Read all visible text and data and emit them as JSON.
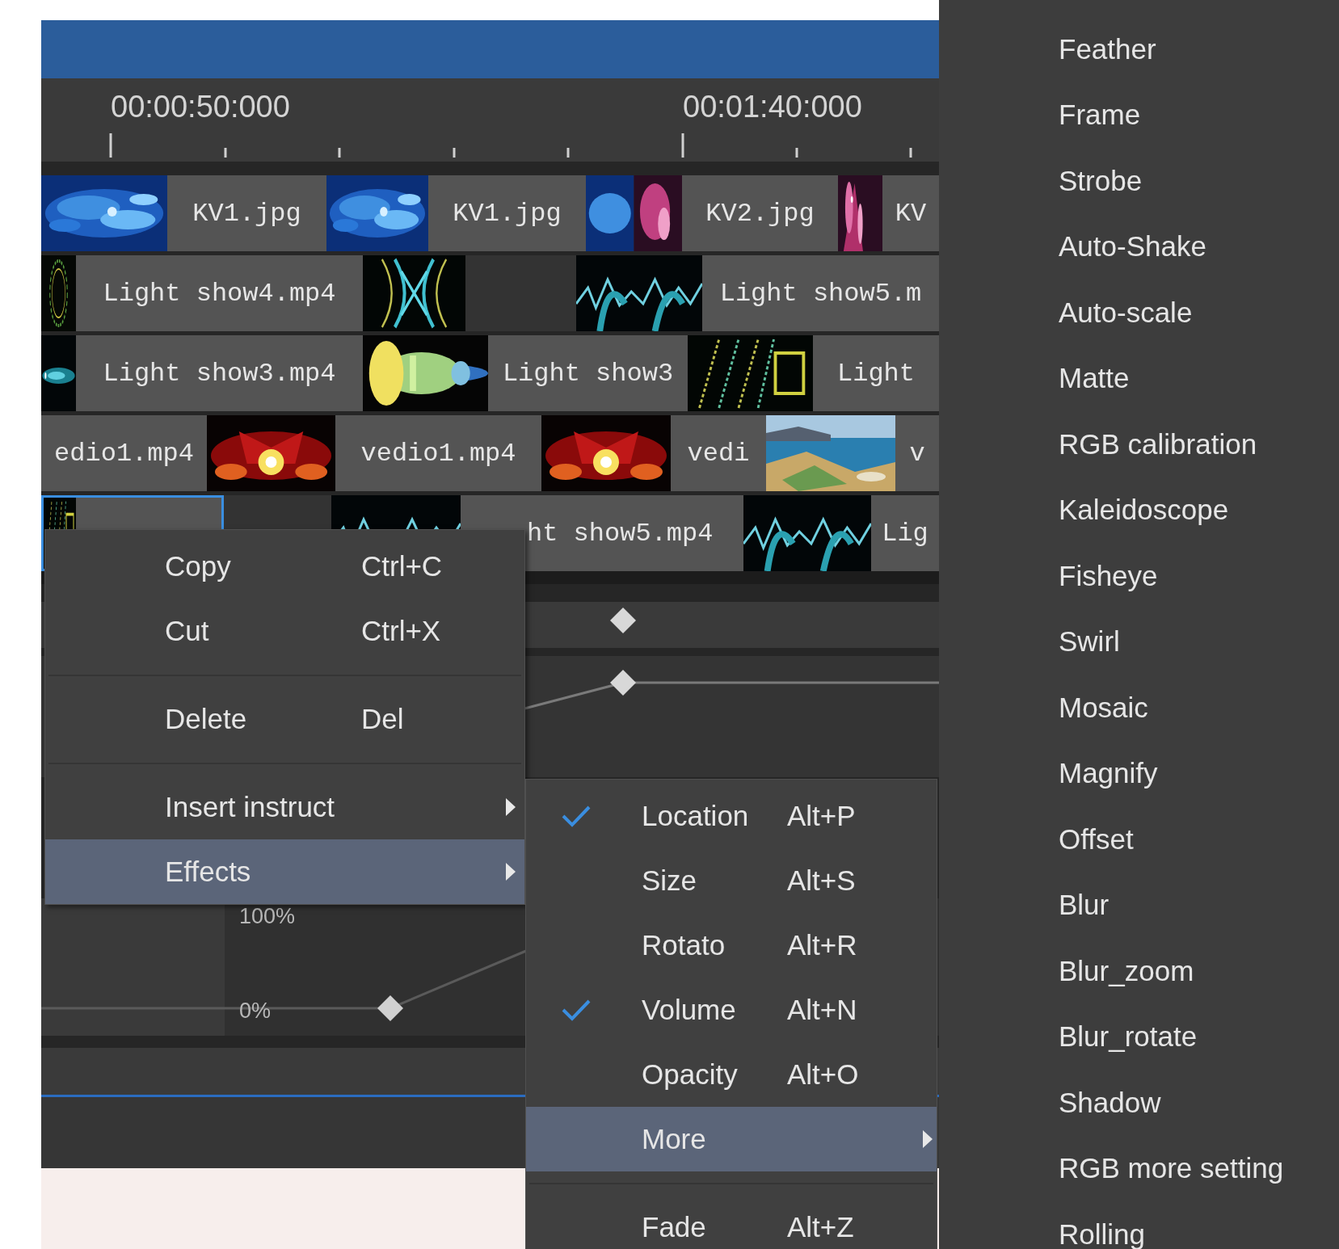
{
  "ruler": {
    "labels": [
      "00:00:50:000",
      "00:01:40:000"
    ]
  },
  "tracks": [
    {
      "clips": [
        {
          "kind": "thumb"
        },
        {
          "kind": "label",
          "text": "KV1.jpg"
        },
        {
          "kind": "thumb"
        },
        {
          "kind": "label",
          "text": "KV1.jpg"
        },
        {
          "kind": "thumb"
        },
        {
          "kind": "label",
          "text": "KV2.jpg"
        },
        {
          "kind": "thumb"
        },
        {
          "kind": "label",
          "text": "KV"
        }
      ]
    },
    {
      "clips": [
        {
          "kind": "thumb"
        },
        {
          "kind": "label",
          "text": "Light show4.mp4"
        },
        {
          "kind": "thumb"
        },
        {
          "kind": "empty"
        },
        {
          "kind": "thumb"
        },
        {
          "kind": "label",
          "text": "Light show5.m"
        }
      ]
    },
    {
      "clips": [
        {
          "kind": "thumb"
        },
        {
          "kind": "label",
          "text": "Light show3.mp4"
        },
        {
          "kind": "thumb"
        },
        {
          "kind": "label",
          "text": "Light show3"
        },
        {
          "kind": "thumb"
        },
        {
          "kind": "label",
          "text": "Light"
        }
      ]
    },
    {
      "clips": [
        {
          "kind": "label",
          "text": "edio1.mp4"
        },
        {
          "kind": "thumb"
        },
        {
          "kind": "label",
          "text": "vedio1.mp4"
        },
        {
          "kind": "thumb"
        },
        {
          "kind": "label",
          "text": "vedi"
        },
        {
          "kind": "thumb"
        },
        {
          "kind": "label",
          "text": "v"
        }
      ]
    },
    {
      "clips": [
        {
          "kind": "clip",
          "selected": true
        },
        {
          "kind": "empty"
        },
        {
          "kind": "thumb"
        },
        {
          "kind": "label",
          "text": "ht show5.mp4"
        },
        {
          "kind": "thumb"
        },
        {
          "kind": "label",
          "text": "Lig"
        }
      ]
    }
  ],
  "keyframes": {
    "axis_labels": [
      "100%",
      "0%"
    ]
  },
  "context_menu": {
    "items": [
      {
        "kind": "item",
        "label": "Copy",
        "shortcut": "Ctrl+C",
        "selected": false,
        "submenu": false
      },
      {
        "kind": "item",
        "label": "Cut",
        "shortcut": "Ctrl+X",
        "selected": false,
        "submenu": false
      },
      {
        "kind": "separator"
      },
      {
        "kind": "item",
        "label": "Delete",
        "shortcut": "Del",
        "selected": false,
        "submenu": false
      },
      {
        "kind": "separator"
      },
      {
        "kind": "item",
        "label": "Insert instruct",
        "selected": false,
        "submenu": true
      },
      {
        "kind": "item",
        "label": "Effects",
        "selected": true,
        "submenu": true
      }
    ]
  },
  "effects_menu": {
    "items": [
      {
        "kind": "item",
        "label": "Location",
        "shortcut": "Alt+P",
        "checked": true,
        "selected": false,
        "submenu": false
      },
      {
        "kind": "item",
        "label": "Size",
        "shortcut": "Alt+S",
        "checked": false,
        "selected": false,
        "submenu": false
      },
      {
        "kind": "item",
        "label": "Rotato",
        "shortcut": "Alt+R",
        "checked": false,
        "selected": false,
        "submenu": false
      },
      {
        "kind": "item",
        "label": "Volume",
        "shortcut": "Alt+N",
        "checked": true,
        "selected": false,
        "submenu": false
      },
      {
        "kind": "item",
        "label": "Opacity",
        "shortcut": "Alt+O",
        "checked": false,
        "selected": false,
        "submenu": false
      },
      {
        "kind": "item",
        "label": "More",
        "checked": false,
        "selected": true,
        "submenu": true
      },
      {
        "kind": "separator"
      },
      {
        "kind": "item",
        "label": "Fade",
        "shortcut": "Alt+Z",
        "checked": false,
        "selected": false,
        "submenu": false
      }
    ]
  },
  "more_menu": {
    "items": [
      {
        "label": "Feather",
        "selected": false
      },
      {
        "label": "Frame",
        "selected": false
      },
      {
        "label": "Strobe",
        "selected": false
      },
      {
        "label": "Auto-Shake",
        "selected": false
      },
      {
        "label": "Auto-scale",
        "selected": false
      },
      {
        "label": "Matte",
        "selected": false
      },
      {
        "label": "RGB calibration",
        "selected": false
      },
      {
        "label": "Kaleidoscope",
        "selected": false
      },
      {
        "label": "Fisheye",
        "selected": false
      },
      {
        "label": "Swirl",
        "selected": false
      },
      {
        "label": "Mosaic",
        "selected": false
      },
      {
        "label": "Magnify",
        "selected": false
      },
      {
        "label": "Offset",
        "selected": false
      },
      {
        "label": "Blur",
        "selected": false
      },
      {
        "label": "Blur_zoom",
        "selected": false
      },
      {
        "label": "Blur_rotate",
        "selected": false
      },
      {
        "label": "Shadow",
        "selected": false
      },
      {
        "label": "RGB more setting",
        "selected": false
      },
      {
        "label": "Rolling",
        "selected": false
      }
    ]
  }
}
